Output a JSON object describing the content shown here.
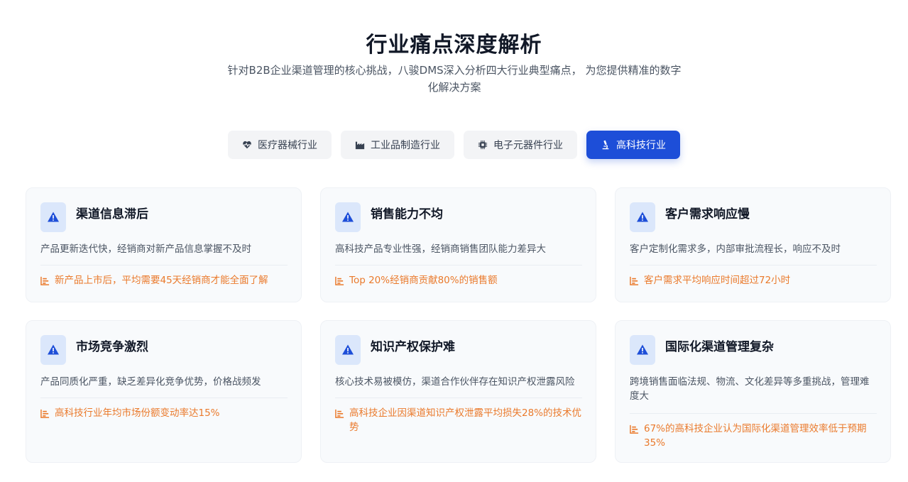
{
  "header": {
    "title": "行业痛点深度解析",
    "subtitle_line1": "针对B2B企业渠道管理的核心挑战，八骏DMS深入分析四大行业典型痛点， 为您提供精准的数字",
    "subtitle_line2": "化解决方案"
  },
  "tabs": [
    {
      "label": "医疗器械行业",
      "icon": "heart-pulse-icon",
      "active": false
    },
    {
      "label": "工业品制造行业",
      "icon": "factory-icon",
      "active": false
    },
    {
      "label": "电子元器件行业",
      "icon": "microchip-icon",
      "active": false
    },
    {
      "label": "高科技行业",
      "icon": "microscope-icon",
      "active": true
    }
  ],
  "cards": [
    {
      "title": "渠道信息滞后",
      "desc": "产品更新迭代快，经销商对新产品信息掌握不及时",
      "stat": "新产品上市后，平均需要45天经销商才能全面了解"
    },
    {
      "title": "销售能力不均",
      "desc": "高科技产品专业性强，经销商销售团队能力差异大",
      "stat": "Top 20%经销商贡献80%的销售额"
    },
    {
      "title": "客户需求响应慢",
      "desc": "客户定制化需求多，内部审批流程长，响应不及时",
      "stat": "客户需求平均响应时间超过72小时"
    },
    {
      "title": "市场竞争激烈",
      "desc": "产品同质化严重，缺乏差异化竞争优势，价格战频发",
      "stat": "高科技行业年均市场份额变动率达15%"
    },
    {
      "title": "知识产权保护难",
      "desc": "核心技术易被模仿，渠道合作伙伴存在知识产权泄露风险",
      "stat": "高科技企业因渠道知识产权泄露平均损失28%的技术优势"
    },
    {
      "title": "国际化渠道管理复杂",
      "desc": "跨境销售面临法规、物流、文化差异等多重挑战，管理难度大",
      "stat": "67%的高科技企业认为国际化渠道管理效率低于预期35%"
    }
  ],
  "colors": {
    "accent": "#1d4ed8",
    "stat": "#ea7a2c",
    "icon_bg": "#dbe7fb",
    "card_bg": "#f8fafc"
  }
}
